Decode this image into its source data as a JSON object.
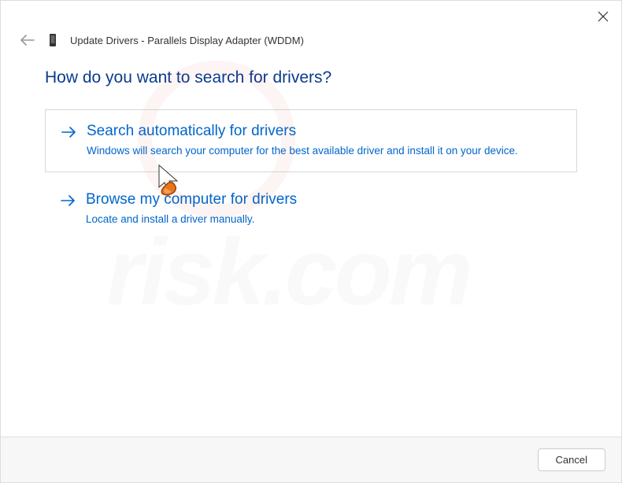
{
  "window": {
    "title": "Update Drivers - Parallels Display Adapter (WDDM)"
  },
  "main": {
    "question": "How do you want to search for drivers?"
  },
  "options": [
    {
      "title": "Search automatically for drivers",
      "description": "Windows will search your computer for the best available driver and install it on your device."
    },
    {
      "title": "Browse my computer for drivers",
      "description": "Locate and install a driver manually."
    }
  ],
  "footer": {
    "cancel_label": "Cancel"
  }
}
